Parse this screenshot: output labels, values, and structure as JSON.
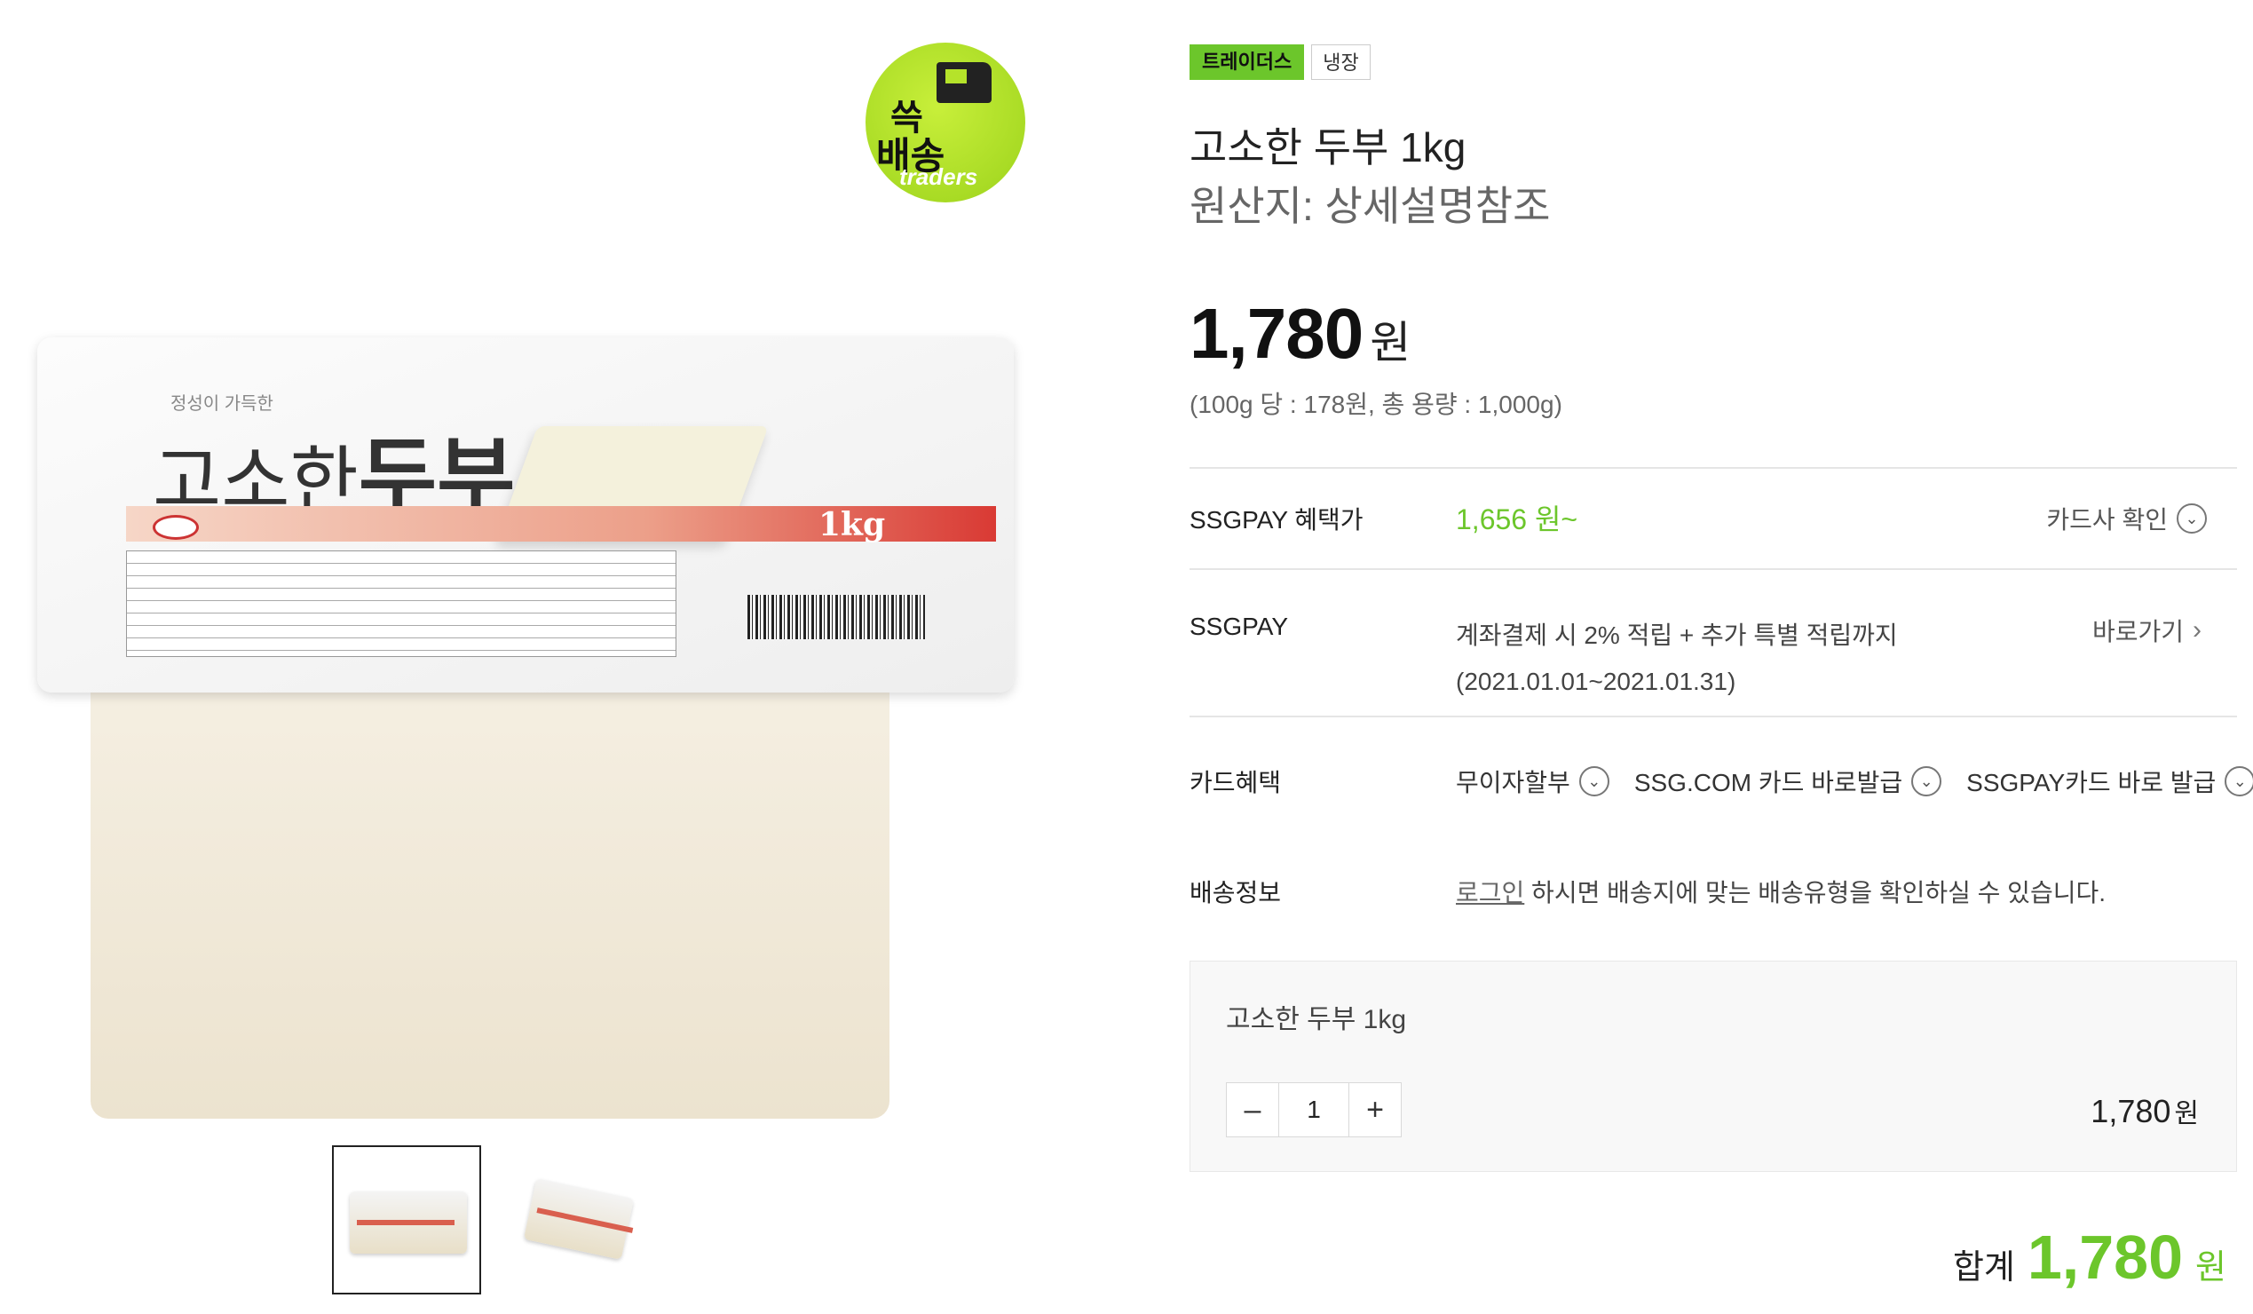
{
  "gallery": {
    "badge": {
      "top": "쓱",
      "bottom": "배송",
      "brand": "traders"
    },
    "package": {
      "subtitle": "정성이 가득한",
      "title_a": "고소한",
      "title_b": "두부",
      "weight": "1kg"
    }
  },
  "product": {
    "tags": [
      "트레이더스",
      "냉장"
    ],
    "title": "고소한 두부 1kg",
    "origin": "원산지: 상세설명참조",
    "price": "1,780",
    "currency": "원",
    "unit_price": "(100g 당 : 178원, 총 용량 : 1,000g)"
  },
  "rows": {
    "ssgpay_benefit": {
      "label": "SSGPAY 혜택가",
      "value": "1,656 원~",
      "action": "카드사 확인"
    },
    "ssgpay": {
      "label": "SSGPAY",
      "line1": "계좌결제 시 2% 적립 + 추가 특별 적립까지",
      "line2": "(2021.01.01~2021.01.31)",
      "action": "바로가기"
    },
    "card": {
      "label": "카드혜택",
      "options": [
        "무이자할부",
        "SSG.COM 카드 바로발급",
        "SSGPAY카드 바로 발급"
      ]
    },
    "delivery": {
      "label": "배송정보",
      "login": "로그인",
      "text": " 하시면 배송지에 맞는 배송유형을 확인하실 수 있습니다."
    }
  },
  "order": {
    "name": "고소한 두부 1kg",
    "quantity": "1",
    "price": "1,780",
    "currency": "원"
  },
  "total": {
    "label": "합계",
    "value": "1,780",
    "currency": "원"
  },
  "colors": {
    "accent": "#6cc62b"
  }
}
